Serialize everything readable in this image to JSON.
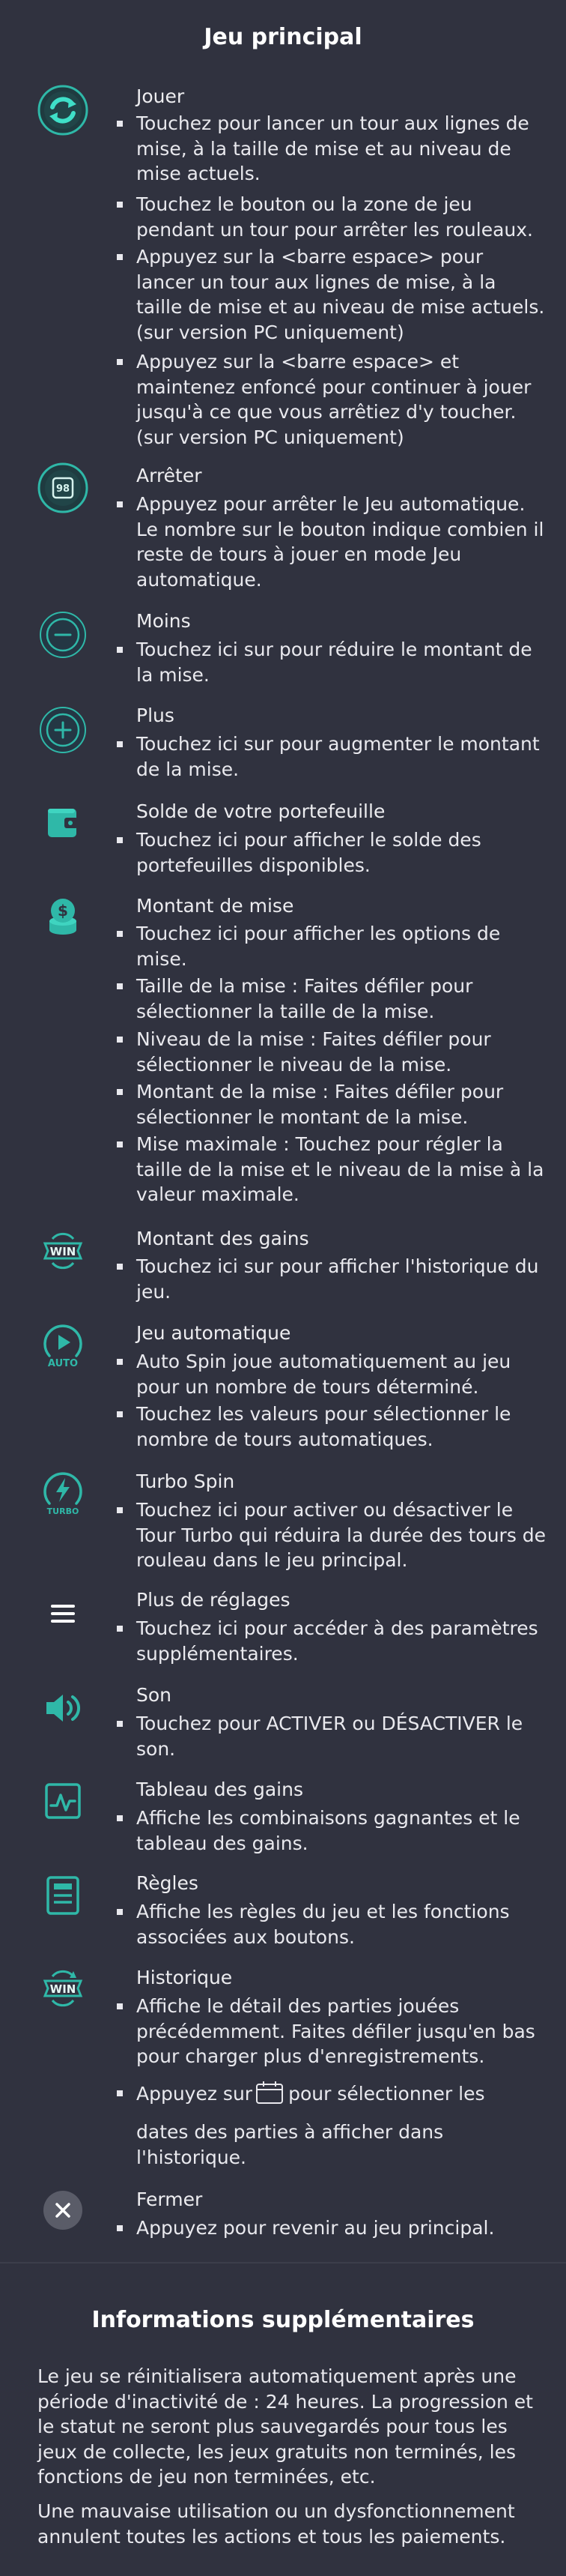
{
  "main_title": "Jeu principal",
  "items": [
    {
      "icon": "spin-icon",
      "title": "Jouer",
      "bullets": [
        "Touchez pour lancer un tour aux lignes de mise, à la taille de mise et au niveau de mise actuels.",
        "Touchez le bouton ou la zone de jeu pendant un tour pour arrêter les rouleaux.",
        "Appuyez sur la <barre espace> pour lancer un tour aux lignes de mise, à la taille de mise et au niveau de mise actuels. (sur version PC uniquement)",
        "Appuyez sur la <barre espace> et maintenez enfoncé pour continuer à jouer jusqu'à ce que vous arrêtiez d'y toucher. (sur version PC uniquement)"
      ]
    },
    {
      "icon": "stop-autoplay-icon",
      "icon_text": "98",
      "title": "Arrêter",
      "bullets": [
        "Appuyez pour arrêter le Jeu automatique. Le nombre sur le bouton indique combien il reste de tours à jouer en mode Jeu automatique."
      ]
    },
    {
      "icon": "minus-icon",
      "title": "Moins",
      "bullets": [
        "Touchez ici sur pour réduire le montant de la mise."
      ]
    },
    {
      "icon": "plus-icon",
      "title": "Plus",
      "bullets": [
        "Touchez ici sur pour augmenter le montant de la mise."
      ]
    },
    {
      "icon": "wallet-icon",
      "title": "Solde de votre portefeuille",
      "bullets": [
        "Touchez ici pour afficher le solde des portefeuilles disponibles."
      ]
    },
    {
      "icon": "coins-icon",
      "title": "Montant de mise",
      "bullets": [
        "Touchez ici pour afficher les options de mise.",
        "Taille de la mise : Faites défiler pour sélectionner la taille de la mise.",
        "Niveau de la mise : Faites défiler pour sélectionner le niveau de la mise.",
        "Montant de la mise : Faites défiler pour sélectionner le montant de la mise.",
        "Mise maximale : Touchez pour régler la taille de la mise et le niveau de la mise à la valeur maximale."
      ]
    },
    {
      "icon": "win-icon",
      "icon_text": "WIN",
      "title": "Montant des gains",
      "bullets": [
        "Touchez ici sur pour afficher l'historique du jeu."
      ]
    },
    {
      "icon": "auto-play-icon",
      "icon_text": "AUTO",
      "title": "Jeu automatique",
      "bullets": [
        "Auto Spin joue automatiquement au jeu pour un nombre de tours déterminé.",
        "Touchez les valeurs pour sélectionner le nombre de tours automatiques."
      ]
    },
    {
      "icon": "turbo-icon",
      "icon_text": "TURBO",
      "title": "Turbo Spin",
      "bullets": [
        "Touchez ici pour activer ou désactiver le Tour Turbo qui réduira la durée des tours de rouleau dans le jeu principal."
      ]
    },
    {
      "icon": "menu-icon",
      "title": "Plus de réglages",
      "bullets": [
        "Touchez ici pour accéder à des paramètres supplémentaires."
      ]
    },
    {
      "icon": "sound-icon",
      "title": "Son",
      "bullets": [
        "Touchez pour ACTIVER ou DÉSACTIVER le son."
      ]
    },
    {
      "icon": "paytable-icon",
      "title": "Tableau des gains",
      "bullets": [
        "Affiche les combinaisons gagnantes et le tableau des gains."
      ]
    },
    {
      "icon": "rules-icon",
      "title": "Règles",
      "bullets": [
        "Affiche les règles du jeu et les fonctions associées aux boutons."
      ]
    },
    {
      "icon": "history-icon",
      "icon_text": "WIN",
      "title": "Historique",
      "bullets": [
        "Affiche le détail des parties jouées précédemment. Faites défiler jusqu'en bas pour charger plus d'enregistrements."
      ],
      "calendar_bullet": {
        "before": "Appuyez sur",
        "icon": "calendar-icon",
        "after": "pour sélectionner les",
        "line2": "dates des parties à afficher dans",
        "line3": "l'historique."
      }
    },
    {
      "icon": "close-icon",
      "title": "Fermer",
      "bullets": [
        "Appuyez pour revenir au jeu principal."
      ]
    }
  ],
  "info_title": "Informations supplémentaires",
  "info_paragraphs": [
    "Le jeu se réinitialisera automatiquement après une période d'inactivité de : 24 heures. La progression et le statut ne seront plus sauvegardés pour tous les jeux de collecte, les jeux gratuits non terminés, les fonctions de jeu non terminées, etc.",
    "Une mauvaise utilisation ou un dysfonctionnement annulent toutes les actions et tous les paiements."
  ],
  "colors": {
    "background": "#30323f",
    "accent": "#2fb8a8",
    "text": "#f2f2f4"
  }
}
